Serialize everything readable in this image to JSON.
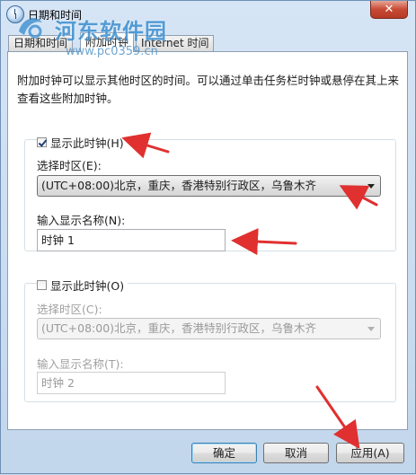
{
  "window": {
    "title": "日期和时间",
    "close_label": "✕"
  },
  "watermark": {
    "name": "河东软件园",
    "url": "www.pc0359.cn"
  },
  "tabs": [
    {
      "label": "日期和时间",
      "active": false
    },
    {
      "label": "附加时钟",
      "active": true
    },
    {
      "label": "Internet 时间",
      "active": false
    }
  ],
  "intro": "附加时钟可以显示其他时区的时间。可以通过单击任务栏时钟或悬停在其上来查看这些附加时钟。",
  "clock1": {
    "show_label": "显示此时钟(H)",
    "checked": true,
    "timezone_label": "选择时区(E):",
    "timezone_value": "(UTC+08:00)北京，重庆，香港特别行政区，乌鲁木齐",
    "name_label": "输入显示名称(N):",
    "name_value": "时钟 1"
  },
  "clock2": {
    "show_label": "显示此时钟(O)",
    "checked": false,
    "timezone_label": "选择时区(C):",
    "timezone_value": "(UTC+08:00)北京，重庆，香港特别行政区，乌鲁木齐",
    "name_label": "输入显示名称(T):",
    "name_value": "时钟 2"
  },
  "buttons": {
    "ok": "确定",
    "cancel": "取消",
    "apply": "应用(A)"
  },
  "colors": {
    "annotation_arrow": "#e03030",
    "watermark": "#3c8fd0"
  }
}
